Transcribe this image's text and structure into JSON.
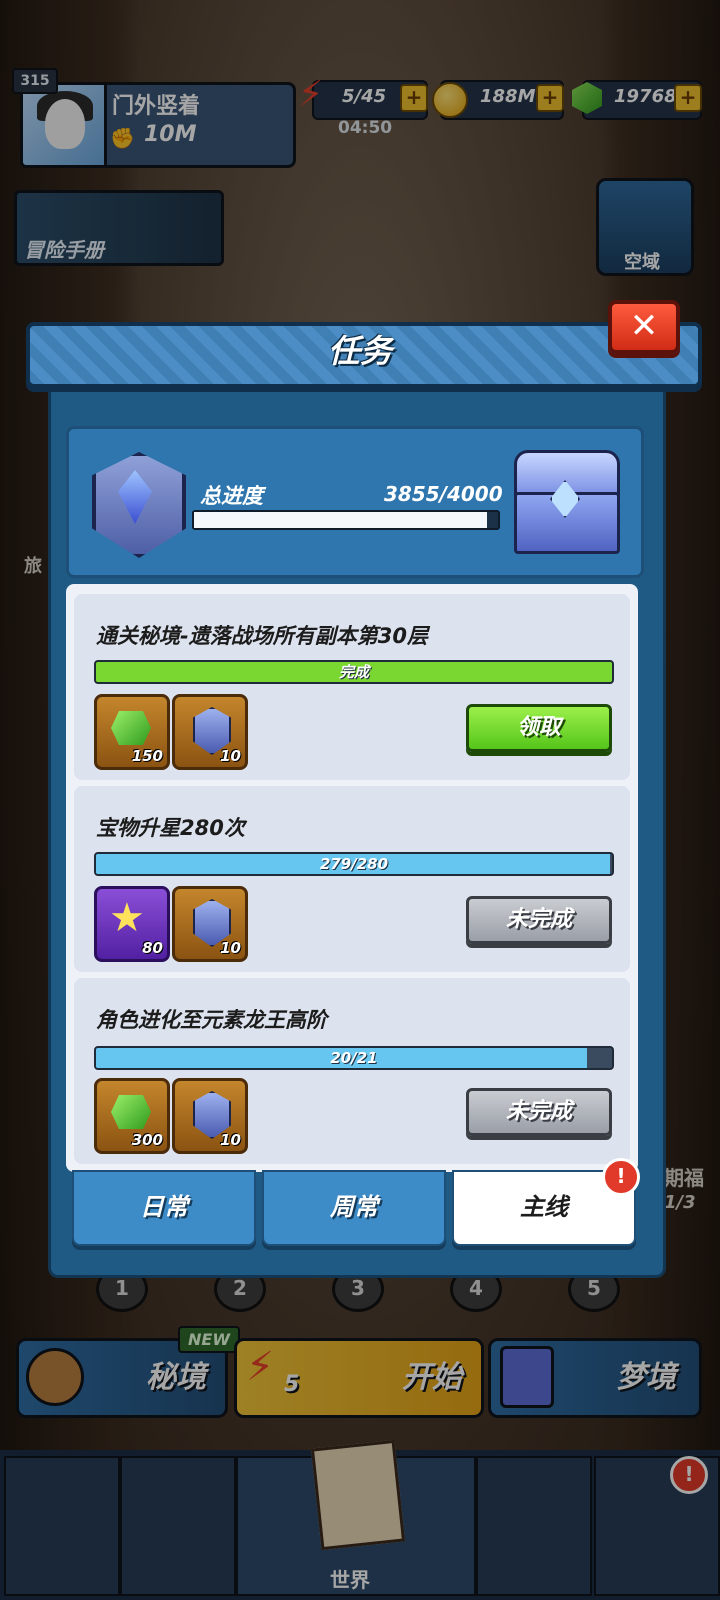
{
  "hud": {
    "level": "315",
    "player_name": "门外竖着",
    "power": "10M",
    "energy": "5/45",
    "energy_timer": "04:50",
    "gold": "188M",
    "gems": "19768",
    "plus": "+"
  },
  "shortcuts": {
    "handbook_label": "冒险手册",
    "kongyu_label": "空域",
    "side_left": "旅",
    "side_right_1": "期福",
    "side_right_2": "1/3"
  },
  "modal": {
    "title": "任务",
    "close": "✕",
    "total_label": "总进度",
    "total_value": "3855/4000",
    "total_progress": 0.964
  },
  "tasks": [
    {
      "title": "通关秘境-遗落战场所有副本第30层",
      "bar_text": "完成",
      "progress": 1.0,
      "bar_color": "#7ad631",
      "rewards": [
        {
          "type": "gems",
          "count": "150"
        },
        {
          "type": "badge",
          "count": "10"
        }
      ],
      "button": "领取",
      "button_style": "green"
    },
    {
      "title": "宝物升星280次",
      "bar_text": "279/280",
      "progress": 0.996,
      "bar_color": "#66c6ef",
      "rewards": [
        {
          "type": "star",
          "count": "80"
        },
        {
          "type": "badge",
          "count": "10"
        }
      ],
      "button": "未完成",
      "button_style": "gray"
    },
    {
      "title": "角色进化至元素龙王高阶",
      "bar_text": "20/21",
      "progress": 0.952,
      "bar_color": "#66c6ef",
      "rewards": [
        {
          "type": "gems",
          "count": "300"
        },
        {
          "type": "badge",
          "count": "10"
        }
      ],
      "button": "未完成",
      "button_style": "gray"
    }
  ],
  "tabs": [
    {
      "label": "日常",
      "active": false
    },
    {
      "label": "周常",
      "active": false
    },
    {
      "label": "主线",
      "active": true
    }
  ],
  "alert_mark": "!",
  "stages": [
    "1",
    "2",
    "3",
    "4",
    "5"
  ],
  "modes": {
    "secret": "秘境",
    "new_tag": "NEW",
    "start": "开始",
    "start_cost": "5",
    "dream": "梦境"
  },
  "bottom_nav": {
    "world_label": "世界"
  },
  "colors": {
    "modal_bg": "#1f5a85",
    "accent_green": "#55c51a",
    "alert_red": "#e23a2a"
  }
}
